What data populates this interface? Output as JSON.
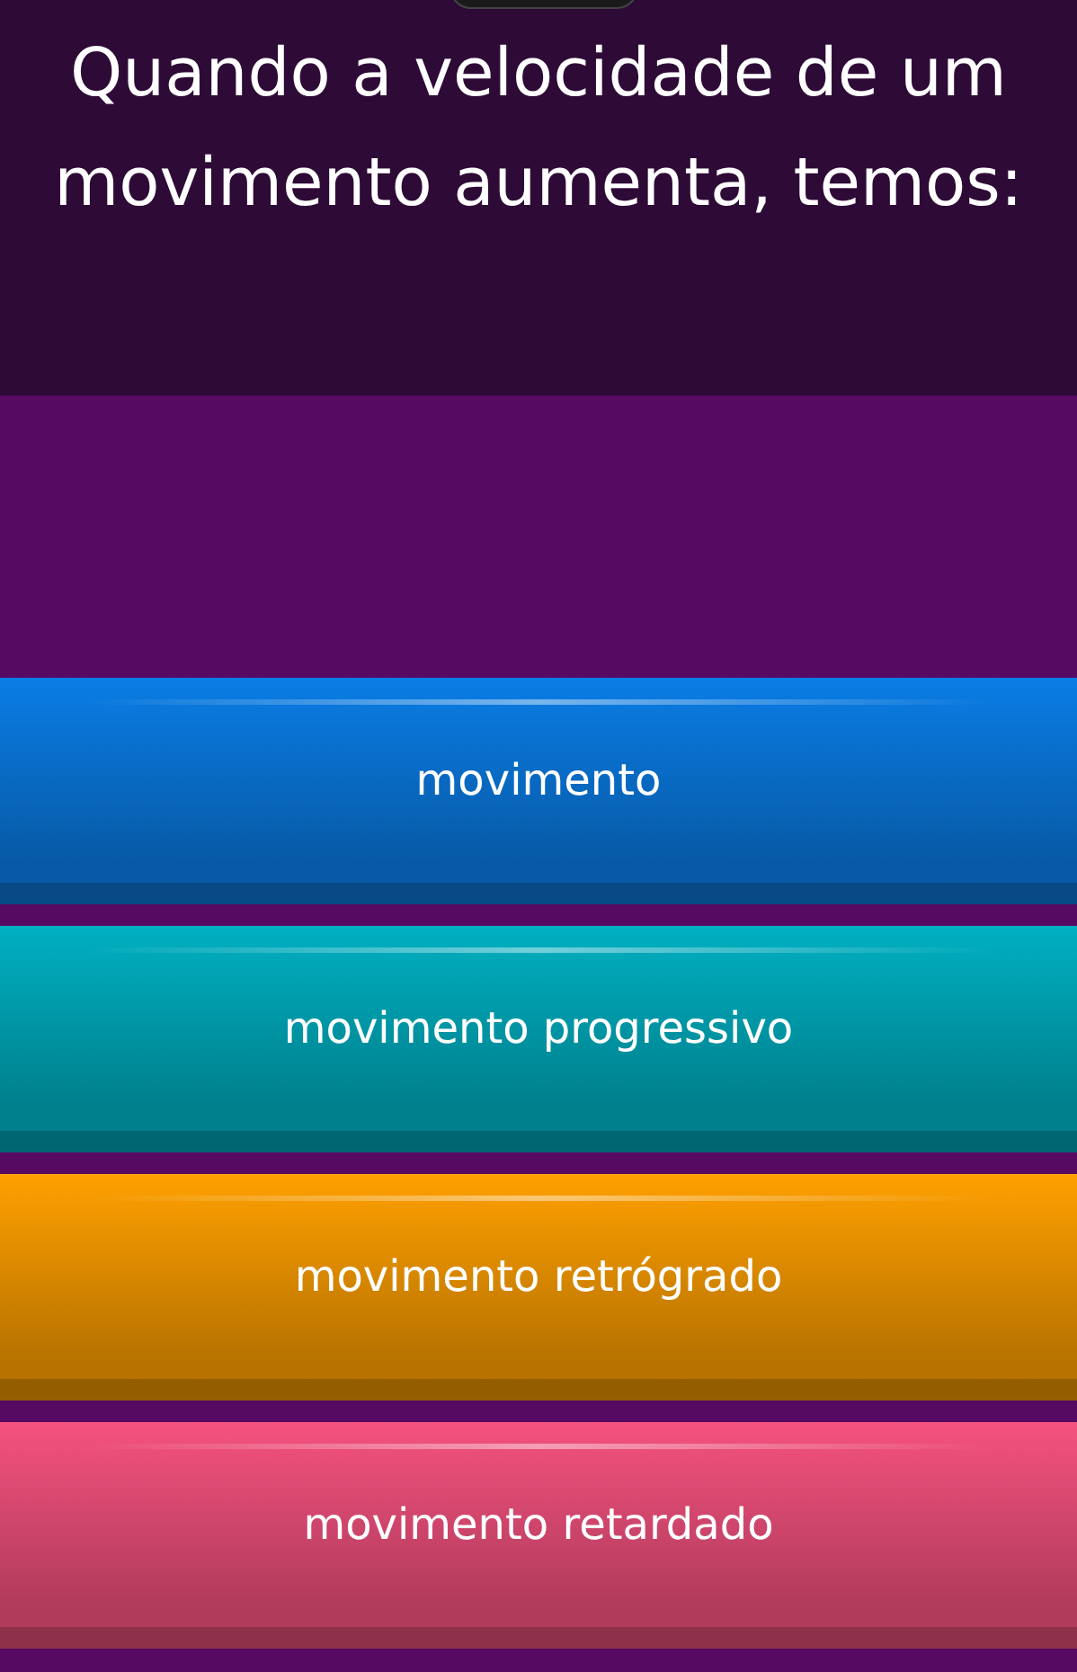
{
  "question": {
    "text": "Quando a velocidade de um movimento aumenta, temos:"
  },
  "options": [
    {
      "label": "movimento",
      "color": "#0a7de6"
    },
    {
      "label": "movimento progressivo",
      "color": "#00b0c2"
    },
    {
      "label": "movimento retrógrado",
      "color": "#ffa000"
    },
    {
      "label": "movimento retardado",
      "color": "#f5527f"
    }
  ]
}
